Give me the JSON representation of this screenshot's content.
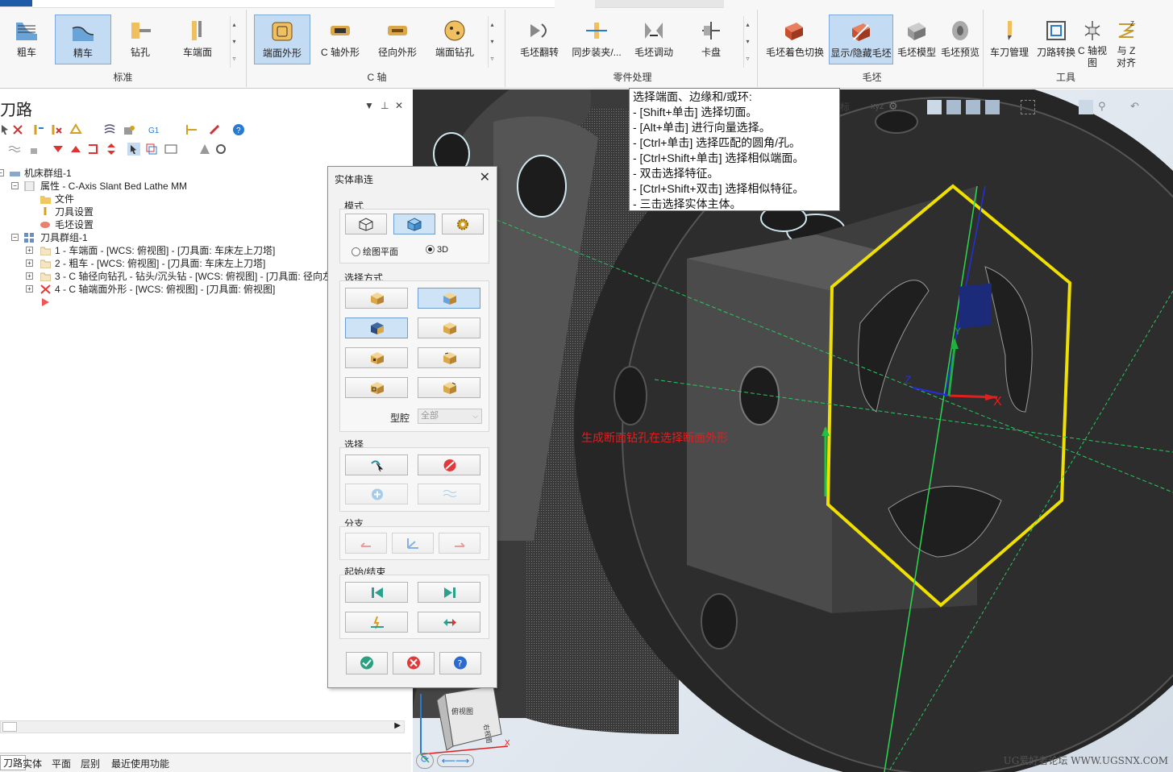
{
  "ribbon": {
    "groups": [
      {
        "label": "标准",
        "buttons": [
          "粗车",
          "精车",
          "钻孔",
          "车端面"
        ]
      },
      {
        "label": "C 轴",
        "buttons": [
          "端面外形",
          "C 轴外形",
          "径向外形",
          "端面钻孔"
        ]
      },
      {
        "label": "零件处理",
        "buttons": [
          "毛坯翻转",
          "同步装夹/...",
          "毛坯调动",
          "卡盘"
        ]
      },
      {
        "label": "毛坯",
        "buttons": [
          "毛坯着色切换",
          "显示/隐藏毛坯",
          "毛坯模型",
          "毛坯预览"
        ]
      },
      {
        "label": "工具",
        "buttons": [
          "车刀管理",
          "刀路转换",
          "C 轴视图",
          "与 Z 对齐"
        ]
      }
    ],
    "selected": [
      "精车",
      "端面外形",
      "显示/隐藏毛坯"
    ]
  },
  "panel": {
    "title": "刀路",
    "tree": [
      "机床群组-1",
      "属性 - C-Axis Slant Bed Lathe MM",
      "文件",
      "刀具设置",
      "毛坯设置",
      "刀具群组-1",
      "1 - 车端面 - [WCS: 俯视图] - [刀具面: 车床左上刀塔]",
      "2 - 粗车 - [WCS: 俯视图] - [刀具面: 车床左上刀塔]",
      "3 - C 轴径向钻孔 - 钻头/沉头钻 - [WCS: 俯视图] - [刀具面: 径向左",
      "4 - C 轴端面外形 - [WCS: 俯视图] - [刀具面: 俯视图]"
    ]
  },
  "bottom_tabs": [
    "刀路",
    "实体",
    "平面",
    "层别",
    "最近使用功能"
  ],
  "dialog": {
    "title": "实体串连",
    "mode_label": "模式",
    "radio_plane": "绘图平面",
    "radio_3d": "3D",
    "select_method_label": "选择方式",
    "cavity_label": "型腔",
    "cavity_value": "全部",
    "select_label": "选择",
    "branch_label": "分支",
    "startend_label": "起始/结束"
  },
  "tooltip": {
    "lines": [
      "选择端面、边缘和/或环:",
      "- [Shift+单击] 选择切面。",
      "- [Alt+单击] 进行向量选择。",
      "- [Ctrl+单击] 选择匹配的圆角/孔。",
      "- [Ctrl+Shift+单击] 选择相似端面。",
      "- 双击选择特征。",
      "- [Ctrl+Shift+双击] 选择相似特征。",
      "- 三击选择实体主体。"
    ]
  },
  "viewport": {
    "annotation": "生成断面钻孔在选择断面外形",
    "watermark": "UG爱好者论坛 WWW.UGSNX.COM",
    "axes": {
      "x": "X",
      "y": "Y",
      "z": "Z"
    },
    "viewcube": [
      "俯视图",
      "右视图"
    ],
    "partial_label": "标"
  },
  "colors": {
    "accent": "#1e5aa8",
    "selected_edge": "#f0e000",
    "part": "#2e2e2e",
    "annotation": "#e31e1e"
  }
}
